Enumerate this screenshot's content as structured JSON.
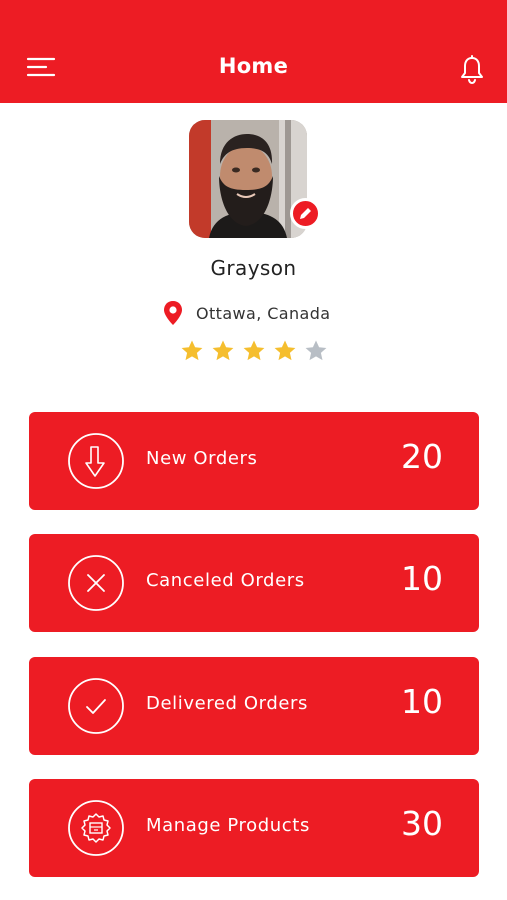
{
  "header": {
    "title": "Home",
    "menu_icon": "hamburger-menu-icon",
    "bell_icon": "notification-bell-icon"
  },
  "profile": {
    "name": "Grayson",
    "location": "Ottawa, Canada",
    "rating": 4,
    "rating_max": 5,
    "edit_icon": "pencil-icon",
    "location_icon": "map-pin-icon"
  },
  "cards": [
    {
      "label": "New Orders",
      "count": "20",
      "icon": "arrow-down-circle-icon"
    },
    {
      "label": "Canceled Orders",
      "count": "10",
      "icon": "x-circle-icon"
    },
    {
      "label": "Delivered Orders",
      "count": "10",
      "icon": "check-circle-icon"
    },
    {
      "label": "Manage Products",
      "count": "30",
      "icon": "gear-box-icon"
    }
  ],
  "colors": {
    "primary": "#ED1C24",
    "star_filled": "#F5BE2E",
    "star_empty": "#B8BEC5",
    "text": "#222222"
  }
}
